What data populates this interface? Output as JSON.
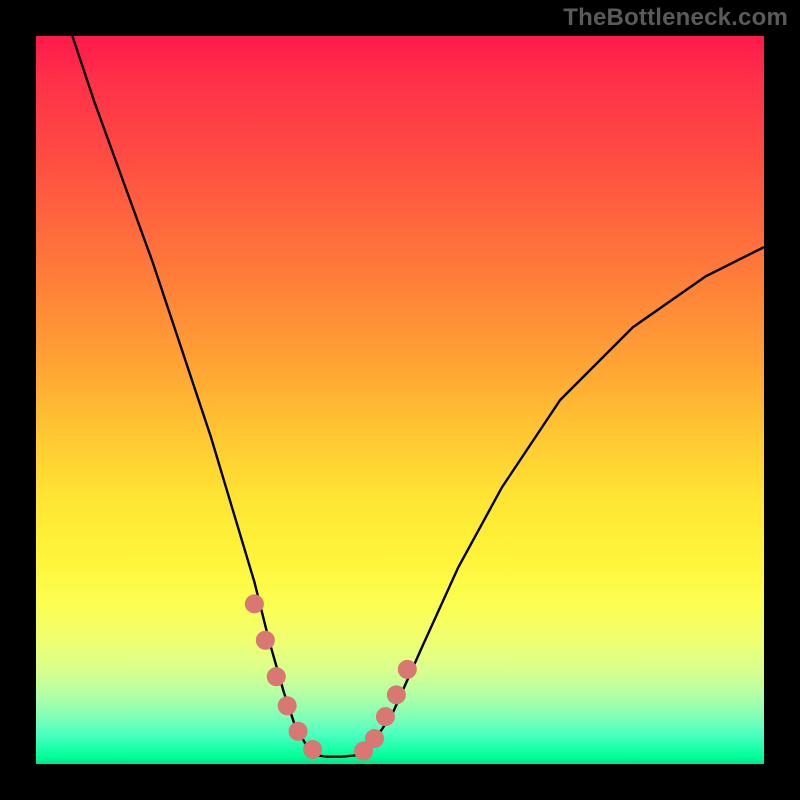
{
  "watermark": "TheBottleneck.com",
  "colors": {
    "background_outer": "#000000",
    "gradient_top": "#ff1a4a",
    "gradient_mid": "#ffe633",
    "gradient_bottom": "#00ff9a",
    "curve": "#000000",
    "markers": "#d97772"
  },
  "chart_data": {
    "type": "line",
    "title": "",
    "xlabel": "",
    "ylabel": "",
    "xlim": [
      0,
      100
    ],
    "ylim": [
      0,
      100
    ],
    "grid": false,
    "legend": false,
    "note": "Single curve; values estimated from pixels. y=0 is at bottom background (green), y=100 at top (red). Curve dips to a flat minimum then rises.",
    "series": [
      {
        "name": "curve",
        "x": [
          5,
          8,
          12,
          16,
          20,
          24,
          27,
          30,
          32,
          34,
          35.5,
          37,
          38.5,
          40,
          42,
          44,
          46,
          49,
          53,
          58,
          64,
          72,
          82,
          92,
          100
        ],
        "y": [
          100,
          91,
          80,
          69,
          57,
          45,
          35,
          25,
          17,
          10,
          5.5,
          2.8,
          1.2,
          1.0,
          1.0,
          1.2,
          2.5,
          7,
          16,
          27,
          38,
          50,
          60,
          67,
          71
        ]
      }
    ],
    "markers": {
      "name": "highlighted-points",
      "note": "Salmon dots near the trough on descending and ascending sides.",
      "x": [
        30,
        31.5,
        33,
        34.5,
        36,
        38,
        45,
        46.5,
        48,
        49.5,
        51
      ],
      "y": [
        22,
        17,
        12,
        8,
        4.5,
        2,
        1.8,
        3.5,
        6.5,
        9.5,
        13
      ]
    }
  }
}
